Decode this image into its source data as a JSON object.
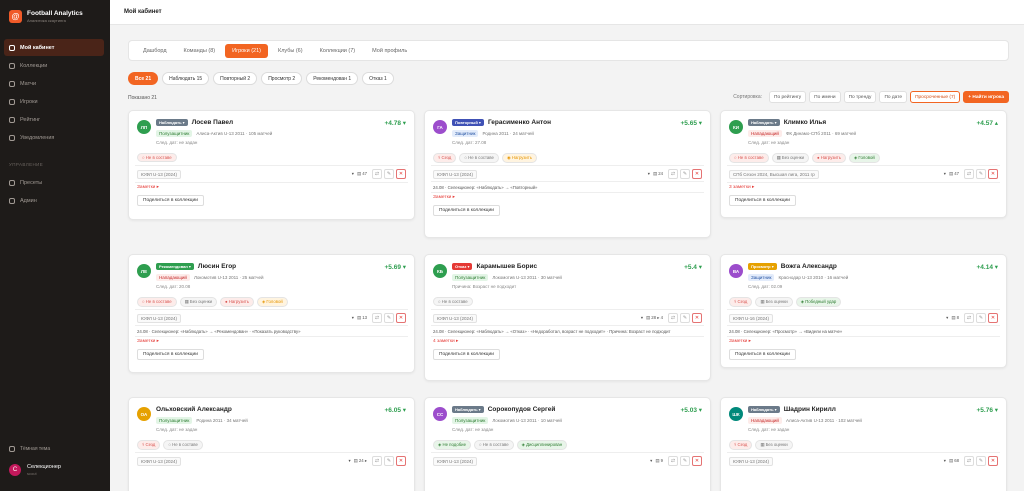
{
  "brand": {
    "title": "Football Analytics",
    "subtitle": "Аналитика скаутинга"
  },
  "sidebar": {
    "items": [
      {
        "label": "Мой кабинет",
        "active": true
      },
      {
        "label": "Коллекции",
        "active": false
      },
      {
        "label": "Матчи",
        "active": false
      },
      {
        "label": "Игроки",
        "active": false
      },
      {
        "label": "Рейтинг",
        "active": false
      },
      {
        "label": "Уведомления",
        "active": false
      }
    ],
    "section_label": "УПРАВЛЕНИЕ",
    "admin_items": [
      {
        "label": "Пресеты"
      },
      {
        "label": "Админ"
      }
    ],
    "theme_label": "Тёмная тема",
    "user": {
      "name": "Селекционер",
      "role": "scout",
      "initial": "С"
    }
  },
  "page_title": "Мой кабинет",
  "tabs": [
    {
      "label": "Дашборд",
      "active": false
    },
    {
      "label": "Команды (8)",
      "active": false
    },
    {
      "label": "Игроки (21)",
      "active": true
    },
    {
      "label": "Клубы (6)",
      "active": false
    },
    {
      "label": "Коллекции (7)",
      "active": false
    },
    {
      "label": "Мой профиль",
      "active": false
    }
  ],
  "filters": [
    {
      "label": "Все",
      "count": "21",
      "active": true
    },
    {
      "label": "Наблюдать",
      "count": "15",
      "active": false
    },
    {
      "label": "Повторный",
      "count": "2",
      "active": false
    },
    {
      "label": "Просмотр",
      "count": "2",
      "active": false
    },
    {
      "label": "Рекомендован",
      "count": "1",
      "active": false
    },
    {
      "label": "Отказ",
      "count": "1",
      "active": false
    }
  ],
  "found_label": "Показано 21",
  "sort": {
    "label": "Сортировка:",
    "options": [
      "По рейтингу",
      "По имени",
      "По тренду",
      "По дате"
    ],
    "overdue_label": "Просроченные (7)",
    "find_label": "+ Найти игрока"
  },
  "icons": {
    "share": "share-icon",
    "edit": "edit-icon",
    "delete": "close-icon"
  },
  "cards": [
    {
      "initials": "ЛП",
      "avatar_color": "#2e9e4f",
      "status": "Наблюдать ▾",
      "status_color": "#6b7a89",
      "name": "Лосев Павел",
      "score": "+4.78 ▾",
      "score_color": "#2e9e4f",
      "type": "Полузащитник",
      "type_bg": "#e3f5e6",
      "type_color": "#2e7d32",
      "meta": "Алиса-Актив U-13 2011 · 105 матчей",
      "info": [
        "След. дат: не задан"
      ],
      "tags": [
        {
          "text": "○ Не в составе",
          "bg": "#fdecea",
          "color": "#d9534f"
        }
      ],
      "league": "ЮФЛ U-13 (2024)",
      "stat1": "▾",
      "stat2": "▤ 47",
      "history": "",
      "notes": "Заметки ▸",
      "notes_color": "#e53935",
      "share": "Поделиться в коллекции"
    },
    {
      "initials": "ГА",
      "avatar_color": "#9c4dcc",
      "status": "Повторный ▾",
      "status_color": "#3f51b5",
      "name": "Герасименко Антон",
      "score": "+5.65 ▾",
      "score_color": "#2e9e4f",
      "type": "Защитник",
      "type_bg": "#e3ecfb",
      "type_color": "#1f4fa0",
      "meta": "Родина 2011 · 24 матчей",
      "info": [
        "След. дат: 27.08"
      ],
      "tags": [
        {
          "text": "⚕ Сезд",
          "bg": "#fdecea",
          "color": "#d9534f"
        },
        {
          "text": "○ Не в составе",
          "bg": "#f5f5f5",
          "color": "#777"
        },
        {
          "text": "◉ Нагрузить",
          "bg": "#fff4e0",
          "color": "#e69500"
        }
      ],
      "league": "ЮФЛ U-13 (2024)",
      "stat1": "▾",
      "stat2": "▤ 24",
      "history": "24.08 · Селекционер: «Наблюдать» → «Повторный»",
      "notes": "Заметки ▸",
      "notes_color": "#e53935",
      "share": "Поделиться в коллекции"
    },
    {
      "initials": "КИ",
      "avatar_color": "#2e9e4f",
      "status": "Наблюдать ▾",
      "status_color": "#6b7a89",
      "name": "Климко Илья",
      "score": "+4.57 ▴",
      "score_color": "#2e9e4f",
      "type": "Нападающий",
      "type_bg": "#fdecea",
      "type_color": "#c62828",
      "meta": "ФК Динамо-СПб 2011 · 69 матчей",
      "info": [
        "След. дат: не задан"
      ],
      "tags": [
        {
          "text": "○ Не в составе",
          "bg": "#fdecea",
          "color": "#d9534f"
        },
        {
          "text": "▦ Без оценки",
          "bg": "#f5f5f5",
          "color": "#777"
        },
        {
          "text": "● Нагрузить",
          "bg": "#fdecea",
          "color": "#d9534f"
        },
        {
          "text": "◈ Головой",
          "bg": "#e8f5e9",
          "color": "#2e7d32"
        }
      ],
      "league": "СПб Сезон 2024, Высшая лига, 2011 гр",
      "stat1": "▾",
      "stat2": "▤ 47",
      "history": "",
      "notes": "3 заметки ▸",
      "notes_color": "#e53935",
      "share": "Поделиться в коллекции"
    },
    {
      "initials": "ЛЕ",
      "avatar_color": "#2e9e4f",
      "status": "Рекомендован ▾",
      "status_color": "#2e9e4f",
      "name": "Люсин Егор",
      "score": "+5.69 ▾",
      "score_color": "#2e9e4f",
      "type": "Нападающий",
      "type_bg": "#fdecea",
      "type_color": "#c62828",
      "meta": "Локомотив U-13 2011 · 25 матчей",
      "info": [
        "След. дат: 20.08"
      ],
      "tags": [
        {
          "text": "○ Не в составе",
          "bg": "#fdecea",
          "color": "#d9534f"
        },
        {
          "text": "▦ Без оценки",
          "bg": "#f5f5f5",
          "color": "#777"
        },
        {
          "text": "● Нагрузить",
          "bg": "#fdecea",
          "color": "#d9534f"
        },
        {
          "text": "◈ Головой",
          "bg": "#fff4e0",
          "color": "#e69500"
        }
      ],
      "league": "ЮФЛ U-13 (2024)",
      "stat1": "▾",
      "stat2": "▤ 13",
      "history": "24.08 · Селекционер: «Наблюдать» → «Рекомендован» · «Показать руководству»",
      "notes": "Заметки ▸",
      "notes_color": "#e53935",
      "share": "Поделиться в коллекции"
    },
    {
      "initials": "КБ",
      "avatar_color": "#2e9e4f",
      "status": "Отказ ▾",
      "status_color": "#e53935",
      "name": "Карамышев Борис",
      "score": "+5.4 ▾",
      "score_color": "#2e9e4f",
      "type": "Полузащитник",
      "type_bg": "#e3f5e6",
      "type_color": "#2e7d32",
      "meta": "Локомотив U-13 2011 · 30 матчей",
      "info": [
        "Причина: Возраст не подходит"
      ],
      "tags": [
        {
          "text": "○ Не в составе",
          "bg": "#f5f5f5",
          "color": "#777"
        }
      ],
      "league": "ЮФЛ U-13 (2024)",
      "stat1": "▾",
      "stat2": "▤ 28 ▸ 4",
      "history": "24.08 · Селекционер: «Наблюдать» → «Отказ» · «Недоработал, возраст не подходит» · Причина: Возраст не подходит",
      "notes": "4 заметки ▸",
      "notes_color": "#e53935",
      "share": "Поделиться в коллекции"
    },
    {
      "initials": "ВА",
      "avatar_color": "#9c4dcc",
      "status": "Просмотр ▾",
      "status_color": "#e6a100",
      "name": "Вожга Александр",
      "score": "+4.14 ▾",
      "score_color": "#2e9e4f",
      "type": "Защитник",
      "type_bg": "#e3ecfb",
      "type_color": "#1f4fa0",
      "meta": "Краснодар U-13 2010 · 16 матчей",
      "info": [
        "След. дат: 02.09"
      ],
      "tags": [
        {
          "text": "⚕ Сезд",
          "bg": "#fdecea",
          "color": "#d9534f"
        },
        {
          "text": "▦ Без оценки",
          "bg": "#f5f5f5",
          "color": "#777"
        },
        {
          "text": "◈ Победный удар",
          "bg": "#e8f5e9",
          "color": "#2e7d32"
        }
      ],
      "league": "ЮФЛ U-16 (2024)",
      "stat1": "▾",
      "stat2": "▤ 8",
      "history": "24.08 · Селекционер: «Просмотр» → «Видели на матче»",
      "notes": "Заметки ▸",
      "notes_color": "#e53935",
      "share": "Поделиться в коллекции"
    },
    {
      "initials": "ОА",
      "avatar_color": "#e6a100",
      "status": "",
      "status_color": "#6b7a89",
      "name": "Ольховский Александр",
      "score": "+6.05 ▾",
      "score_color": "#2e9e4f",
      "type": "Полузащитник",
      "type_bg": "#e3f5e6",
      "type_color": "#2e7d32",
      "meta": "Родина 2011 · 34 матчей",
      "info": [
        "След. дат: не задан"
      ],
      "tags": [
        {
          "text": "⚕ Сезд",
          "bg": "#fdecea",
          "color": "#d9534f"
        },
        {
          "text": "○ Не в составе",
          "bg": "#f5f5f5",
          "color": "#777"
        }
      ],
      "league": "ЮФЛ U-13 (2024)",
      "stat1": "▾",
      "stat2": "▤ 24 ▸",
      "history": "",
      "notes": "",
      "notes_color": "#e53935",
      "share": ""
    },
    {
      "initials": "СС",
      "avatar_color": "#9c4dcc",
      "status": "Наблюдать ▾",
      "status_color": "#6b7a89",
      "name": "Сорокопудов Сергей",
      "score": "+5.03 ▾",
      "score_color": "#2e9e4f",
      "type": "Полузащитник",
      "type_bg": "#e3f5e6",
      "type_color": "#2e7d32",
      "meta": "Локомотив U-13 2011 · 10 матчей",
      "info": [
        "След. дат: не задан"
      ],
      "tags": [
        {
          "text": "◈ Не подобие",
          "bg": "#e8f5e9",
          "color": "#2e7d32"
        },
        {
          "text": "○ Не в составе",
          "bg": "#f5f5f5",
          "color": "#777"
        },
        {
          "text": "◈ Дисциплинирован",
          "bg": "#e8f5e9",
          "color": "#2e7d32"
        }
      ],
      "league": "ЮФЛ U-13 (2024)",
      "stat1": "▾",
      "stat2": "▤ 9",
      "history": "",
      "notes": "",
      "notes_color": "#e53935",
      "share": ""
    },
    {
      "initials": "ШК",
      "avatar_color": "#00897b",
      "status": "Наблюдать ▾",
      "status_color": "#6b7a89",
      "name": "Шадрин Кирилл",
      "score": "+5.76 ▾",
      "score_color": "#2e9e4f",
      "type": "Нападающий",
      "type_bg": "#fdecea",
      "type_color": "#c62828",
      "meta": "Алиса-Актив U-13 2011 · 102 матчей",
      "info": [
        "След. дат: не задан"
      ],
      "tags": [
        {
          "text": "⚕ Сезд",
          "bg": "#fdecea",
          "color": "#d9534f"
        },
        {
          "text": "▦ Без оценки",
          "bg": "#f5f5f5",
          "color": "#777"
        }
      ],
      "league": "ЮФЛ U-13 (2024)",
      "stat1": "▾",
      "stat2": "▤ 68",
      "history": "",
      "notes": "",
      "notes_color": "#e53935",
      "share": ""
    }
  ]
}
